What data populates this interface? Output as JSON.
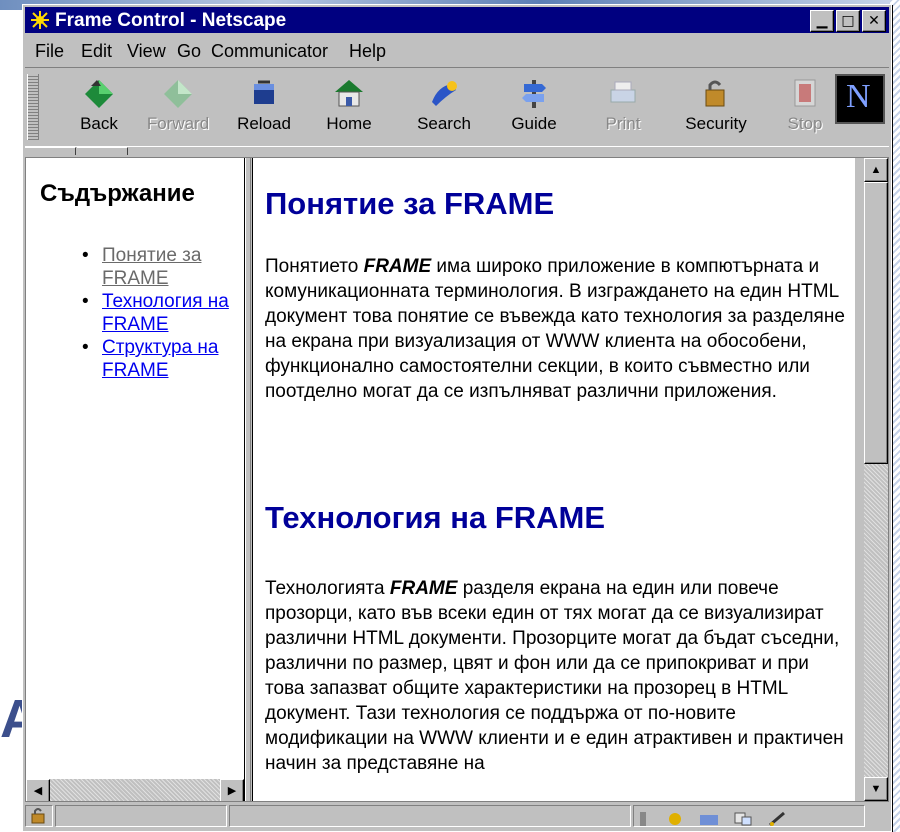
{
  "window": {
    "title": "Frame Control - Netscape",
    "controls": [
      "minimize",
      "maximize",
      "close"
    ]
  },
  "menu": [
    "File",
    "Edit",
    "View",
    "Go",
    "Communicator",
    "Help"
  ],
  "toolbar": [
    {
      "label": "Back",
      "icon": "back-icon",
      "enabled": true
    },
    {
      "label": "Forward",
      "icon": "forward-icon",
      "enabled": false
    },
    {
      "label": "Reload",
      "icon": "reload-icon",
      "enabled": true
    },
    {
      "label": "Home",
      "icon": "home-icon",
      "enabled": true
    },
    {
      "label": "Search",
      "icon": "search-icon",
      "enabled": true
    },
    {
      "label": "Guide",
      "icon": "guide-icon",
      "enabled": true
    },
    {
      "label": "Print",
      "icon": "print-icon",
      "enabled": false
    },
    {
      "label": "Security",
      "icon": "security-icon",
      "enabled": true
    },
    {
      "label": "Stop",
      "icon": "stop-icon",
      "enabled": false
    }
  ],
  "logo": "N",
  "toc": {
    "title": "Съдържание",
    "items": [
      {
        "label": "Понятие за FRAME",
        "visited": true
      },
      {
        "label": "Технология на FRAME",
        "visited": false
      },
      {
        "label": "Структура на FRAME",
        "visited": false
      }
    ]
  },
  "content": {
    "heading1": "Понятие за FRAME",
    "para1_before": "Понятието ",
    "para1_bold": "FRAME",
    "para1_after": " има широко приложение в компютърната и комуникационната терминология. В изграждането на един HTML документ това понятие се въвежда като технология за разделяне на екрана при визуализация от WWW клиента на обособени, функционално самостоятелни секции, в които съвместно или поотделно могат да се изпълняват различни приложения.",
    "heading2": "Технология на FRAME",
    "para2_before": "Технологията ",
    "para2_bold": "FRAME",
    "para2_after": " разделя екрана на един или повече прозорци, като във всеки един от тях могат да се визуализират различни HTML документи. Прозорците могат да бъдат съседни, различни по размер, цвят и фон или да се припокриват и при това запазват общите характеристики на прозорец в HTML документ. Тази технология се поддържа от по-новите модификации на WWW клиенти и е един атрактивен и практичен начин за представяне на"
  },
  "background_text": "A:",
  "colors": {
    "titlebar": "#000080",
    "heading": "#000099",
    "link": "#0000ee",
    "visited": "#6a6a6a",
    "chrome": "#c0c0c0"
  }
}
